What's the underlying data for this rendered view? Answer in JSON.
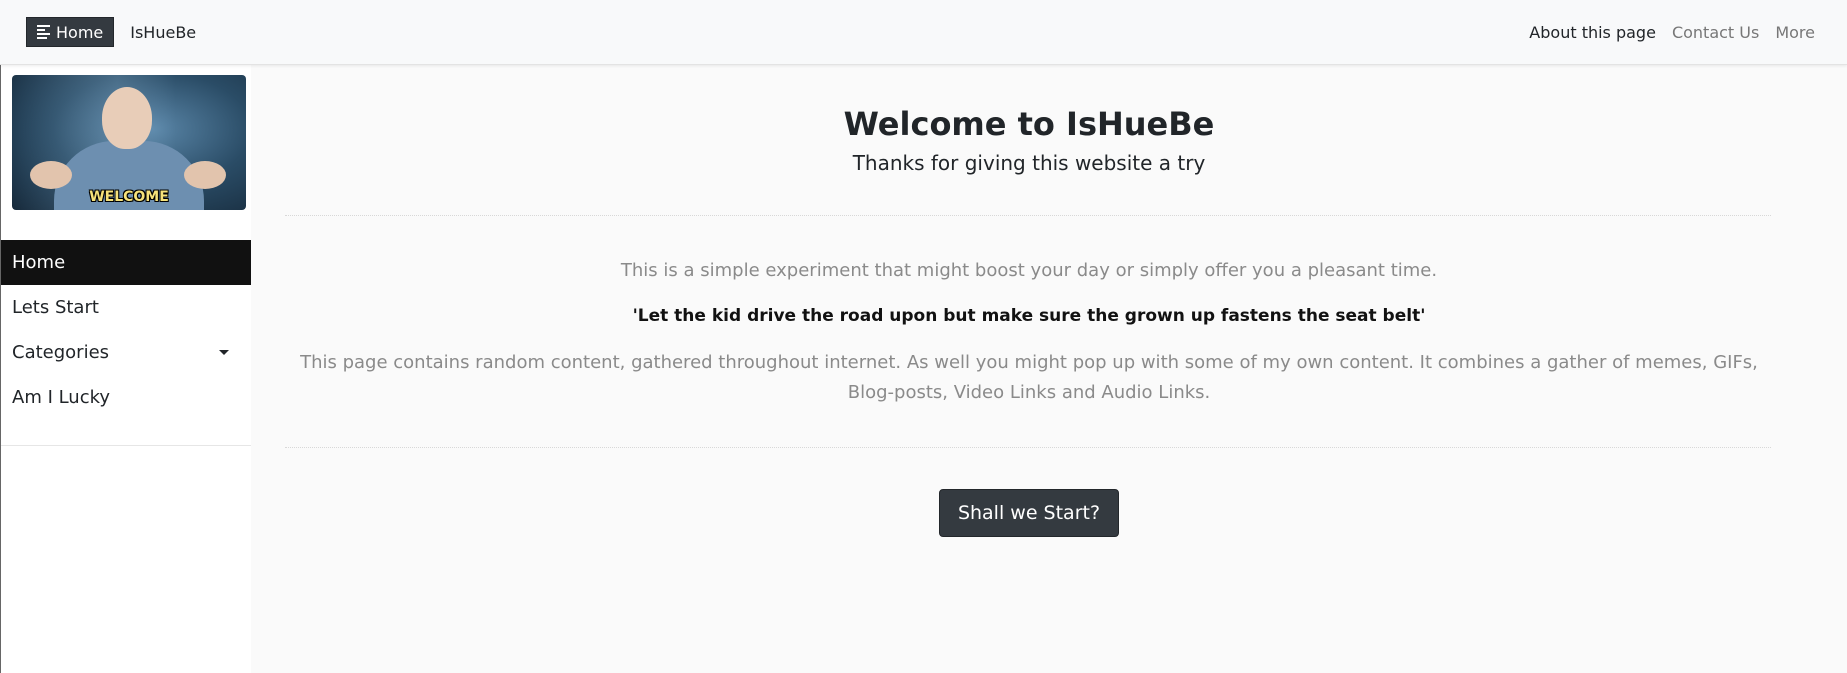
{
  "navbar": {
    "toggle_label": "Home",
    "brand": "IsHueBe",
    "links": [
      "About this page",
      "Contact Us",
      "More"
    ]
  },
  "sidebar": {
    "logo_caption": "WELCOME",
    "items": [
      {
        "label": "Home"
      },
      {
        "label": "Lets Start"
      },
      {
        "label": "Categories"
      },
      {
        "label": "Am I Lucky"
      }
    ]
  },
  "main": {
    "title": "Welcome to IsHueBe",
    "subtitle": "Thanks for giving this website a try",
    "intro": "This is a simple experiment that might boost your day or simply offer you a pleasant time.",
    "quote": "'Let the kid drive the road upon but make sure the grown up fastens the seat belt'",
    "description": "This page contains random content, gathered throughout internet. As well you might pop up with some of my own content. It combines a gather of memes, GIFs, Blog-posts, Video Links and Audio Links.",
    "start_button": "Shall we Start?"
  },
  "colors": {
    "dark": "#343a40",
    "active_menu": "#111111",
    "muted_text": "#8a8a8a"
  }
}
